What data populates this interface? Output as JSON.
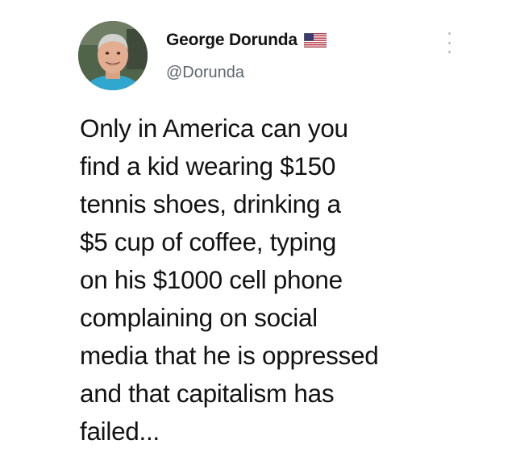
{
  "user": {
    "display_name": "George Dorunda",
    "handle": "@Dorunda",
    "avatar_icon": "user-photo-avatar",
    "badge_icon": "us-flag-icon"
  },
  "menu": {
    "icon": "more-options-vertical-icon"
  },
  "tweet": {
    "lines": [
      "Only in America can you",
      "find a kid wearing $150",
      "tennis shoes, drinking a",
      "$5 cup of coffee, typing",
      "on his $1000 cell phone",
      "complaining on social",
      "media that he is oppressed",
      "and that capitalism has",
      "failed..."
    ]
  },
  "colors": {
    "background": "#ffffff",
    "text": "#121212",
    "handle": "#5f6670",
    "menu_dots": "#b7bcc2"
  }
}
